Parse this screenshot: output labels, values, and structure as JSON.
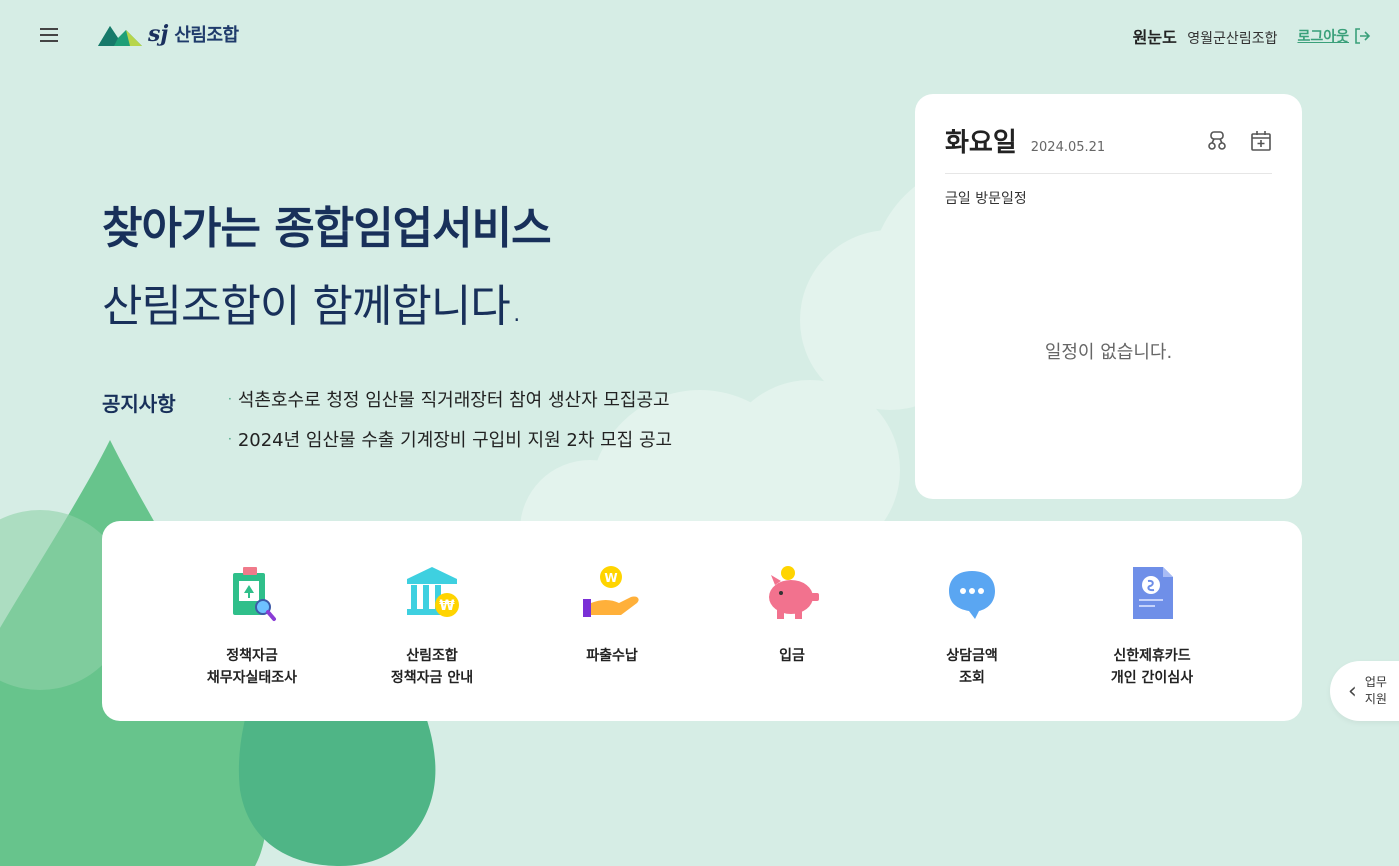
{
  "header": {
    "logo_sj": "sj",
    "logo_text": "산림조합",
    "user_name": "원눈도",
    "user_org": "영월군산림조합",
    "logout": "로그아웃"
  },
  "hero": {
    "title": "찾아가는 종합임업서비스",
    "subtitle": "산림조합이 함께합니다."
  },
  "notice": {
    "label": "공지사항",
    "items": [
      "석촌호수로 청정 임산물 직거래장터 참여 생산자 모집공고",
      "2024년 임산물 수출 기계장비 구입비 지원 2차 모집 공고"
    ]
  },
  "schedule": {
    "day": "화요일",
    "date": "2024.05.21",
    "subtitle": "금일 방문일정",
    "empty": "일정이 없습니다."
  },
  "quick_menu": [
    {
      "line1": "정책자금",
      "line2": "채무자실태조사",
      "icon": "document-search-icon"
    },
    {
      "line1": "산림조합",
      "line2": "정책자금 안내",
      "icon": "bank-won-icon"
    },
    {
      "line1": "파출수납",
      "line2": "",
      "icon": "hand-coin-icon"
    },
    {
      "line1": "입금",
      "line2": "",
      "icon": "piggy-bank-icon"
    },
    {
      "line1": "상담금액",
      "line2": "조회",
      "icon": "chat-bubble-icon"
    },
    {
      "line1": "신한제휴카드",
      "line2": "개인 간이심사",
      "icon": "card-document-icon"
    }
  ],
  "side_tab": {
    "line1": "업무",
    "line2": "지원"
  },
  "colors": {
    "background": "#d6ede5",
    "navy": "#18305a",
    "accent_green": "#3aa07a"
  }
}
